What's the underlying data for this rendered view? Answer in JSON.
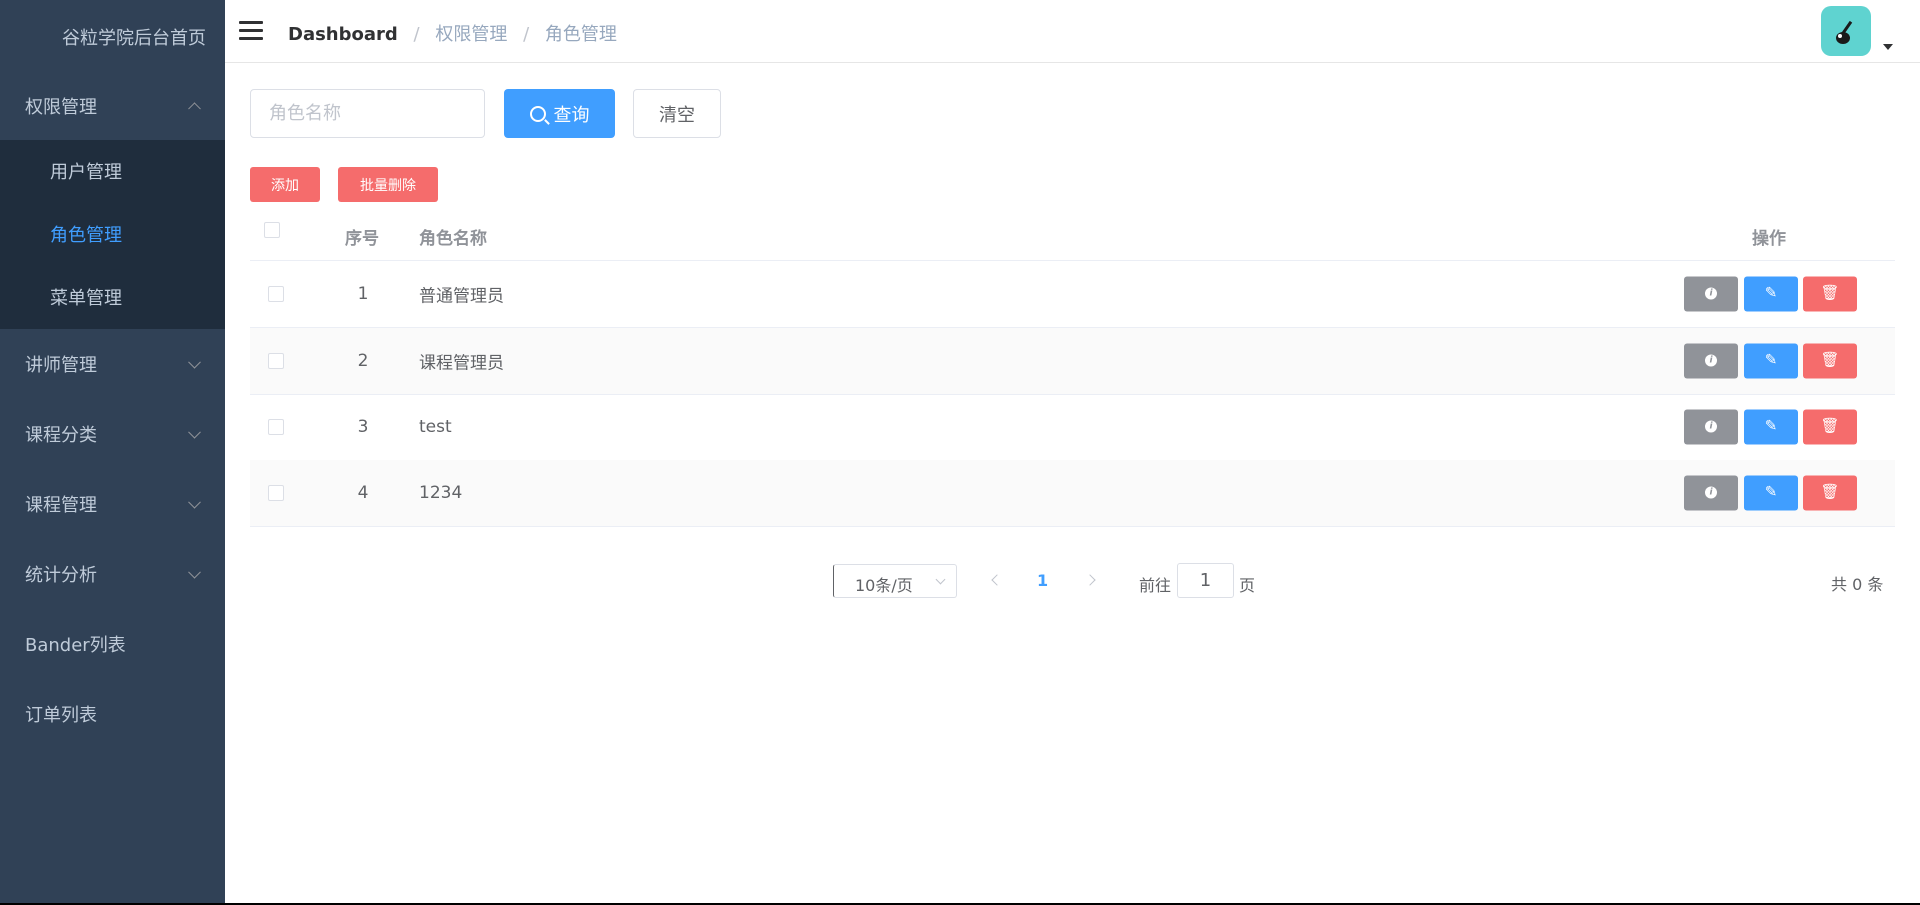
{
  "sidebar": {
    "title": "谷粒学院后台首页",
    "groups": [
      {
        "label": "权限管理",
        "expanded": true
      },
      {
        "label": "讲师管理"
      },
      {
        "label": "课程分类"
      },
      {
        "label": "课程管理"
      },
      {
        "label": "统计分析"
      }
    ],
    "subitems": [
      "用户管理",
      "角色管理",
      "菜单管理"
    ],
    "active_subitem": "角色管理",
    "plain_items": [
      "Bander列表",
      "订单列表"
    ]
  },
  "header": {
    "breadcrumb": [
      "Dashboard",
      "权限管理",
      "角色管理"
    ],
    "separator": "/"
  },
  "search": {
    "placeholder": "角色名称",
    "value": "",
    "query_label": "查询",
    "clear_label": "清空"
  },
  "toolbar": {
    "add_label": "添加",
    "batch_delete_label": "批量删除"
  },
  "table": {
    "columns": [
      "序号",
      "角色名称",
      "操作"
    ],
    "rows": [
      {
        "no": "1",
        "name": "普通管理员"
      },
      {
        "no": "2",
        "name": "课程管理员"
      },
      {
        "no": "3",
        "name": "test"
      },
      {
        "no": "4",
        "name": "1234"
      }
    ]
  },
  "pagination": {
    "page_size": "10条/页",
    "current_page": "1",
    "goto_prefix": "前往",
    "goto_value": "1",
    "goto_suffix": "页",
    "total": "共 0 条"
  },
  "colors": {
    "sidebar_bg": "#304156",
    "submenu_bg": "#1f2d3d",
    "primary": "#409eff",
    "danger": "#f56c6c",
    "info": "#909399"
  }
}
